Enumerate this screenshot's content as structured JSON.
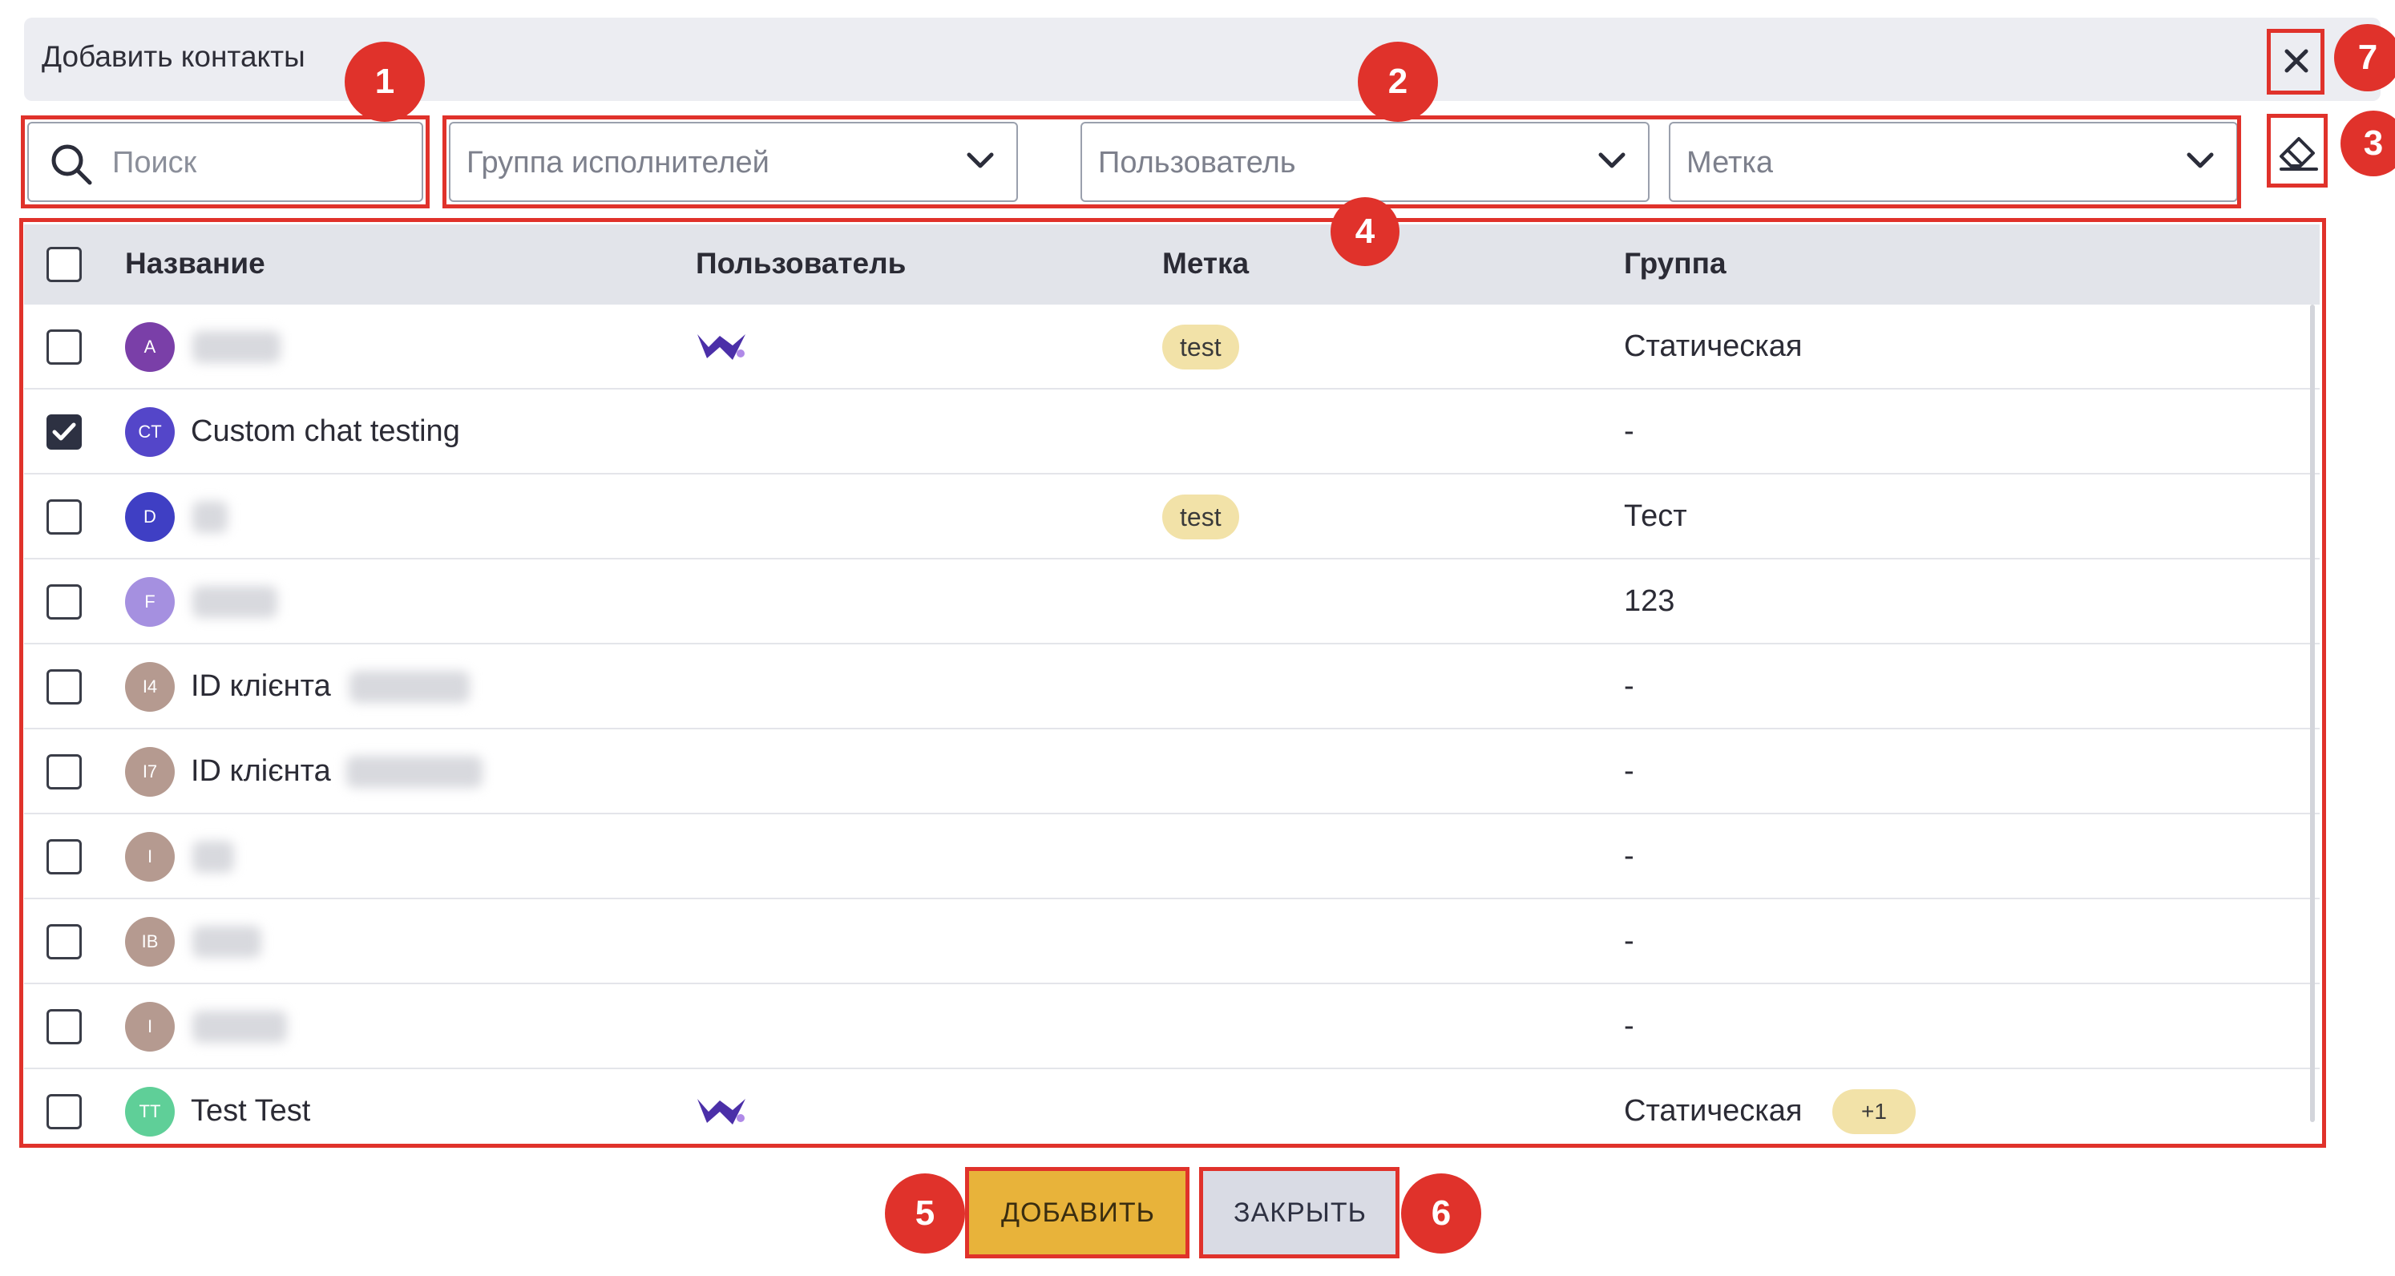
{
  "dialog": {
    "title": "Добавить контакты"
  },
  "filters": {
    "search_placeholder": "Поиск",
    "group_placeholder": "Группа исполнителей",
    "user_placeholder": "Пользователь",
    "tag_placeholder": "Метка"
  },
  "table": {
    "headers": {
      "name": "Название",
      "user": "Пользователь",
      "tag": "Метка",
      "group": "Группа"
    },
    "rows": [
      {
        "initials": "A",
        "name": "",
        "checked": false,
        "user_icon": true,
        "tag": "test",
        "group": "Статическая",
        "extra": "",
        "avatar_color": "#7a3fa8"
      },
      {
        "initials": "CT",
        "name": "Custom chat testing",
        "checked": true,
        "user_icon": false,
        "tag": "",
        "group": "-",
        "extra": "",
        "avatar_color": "#5446c9"
      },
      {
        "initials": "D",
        "name": "",
        "checked": false,
        "user_icon": false,
        "tag": "test",
        "group": "Тест",
        "extra": "",
        "avatar_color": "#3f3fc4"
      },
      {
        "initials": "F",
        "name": "",
        "checked": false,
        "user_icon": false,
        "tag": "",
        "group": "123",
        "extra": "",
        "avatar_color": "#a590e0"
      },
      {
        "initials": "I4",
        "name": "ID клієнта",
        "checked": false,
        "user_icon": false,
        "tag": "",
        "group": "-",
        "extra": "",
        "avatar_color": "#b59a90"
      },
      {
        "initials": "I7",
        "name": "ID клієнта",
        "checked": false,
        "user_icon": false,
        "tag": "",
        "group": "-",
        "extra": "",
        "avatar_color": "#b59a90"
      },
      {
        "initials": "I",
        "name": "",
        "checked": false,
        "user_icon": false,
        "tag": "",
        "group": "-",
        "extra": "",
        "avatar_color": "#b59a90"
      },
      {
        "initials": "IB",
        "name": "",
        "checked": false,
        "user_icon": false,
        "tag": "",
        "group": "-",
        "extra": "",
        "avatar_color": "#b59a90"
      },
      {
        "initials": "I",
        "name": "",
        "checked": false,
        "user_icon": false,
        "tag": "",
        "group": "-",
        "extra": "",
        "avatar_color": "#b59a90"
      },
      {
        "initials": "TT",
        "name": "Test Test",
        "checked": false,
        "user_icon": true,
        "tag": "",
        "group": "Статическая",
        "extra": "+1",
        "avatar_color": "#5fcf98"
      }
    ]
  },
  "buttons": {
    "add": "ДОБАВИТЬ",
    "close": "ЗАКРЫТЬ"
  },
  "markers": [
    "1",
    "2",
    "3",
    "4",
    "5",
    "6",
    "7"
  ],
  "colors": {
    "marker": "#e0322b",
    "add_button": "#e8b33a",
    "close_button": "#d9dbe4",
    "tag": "#f2e2a8"
  }
}
